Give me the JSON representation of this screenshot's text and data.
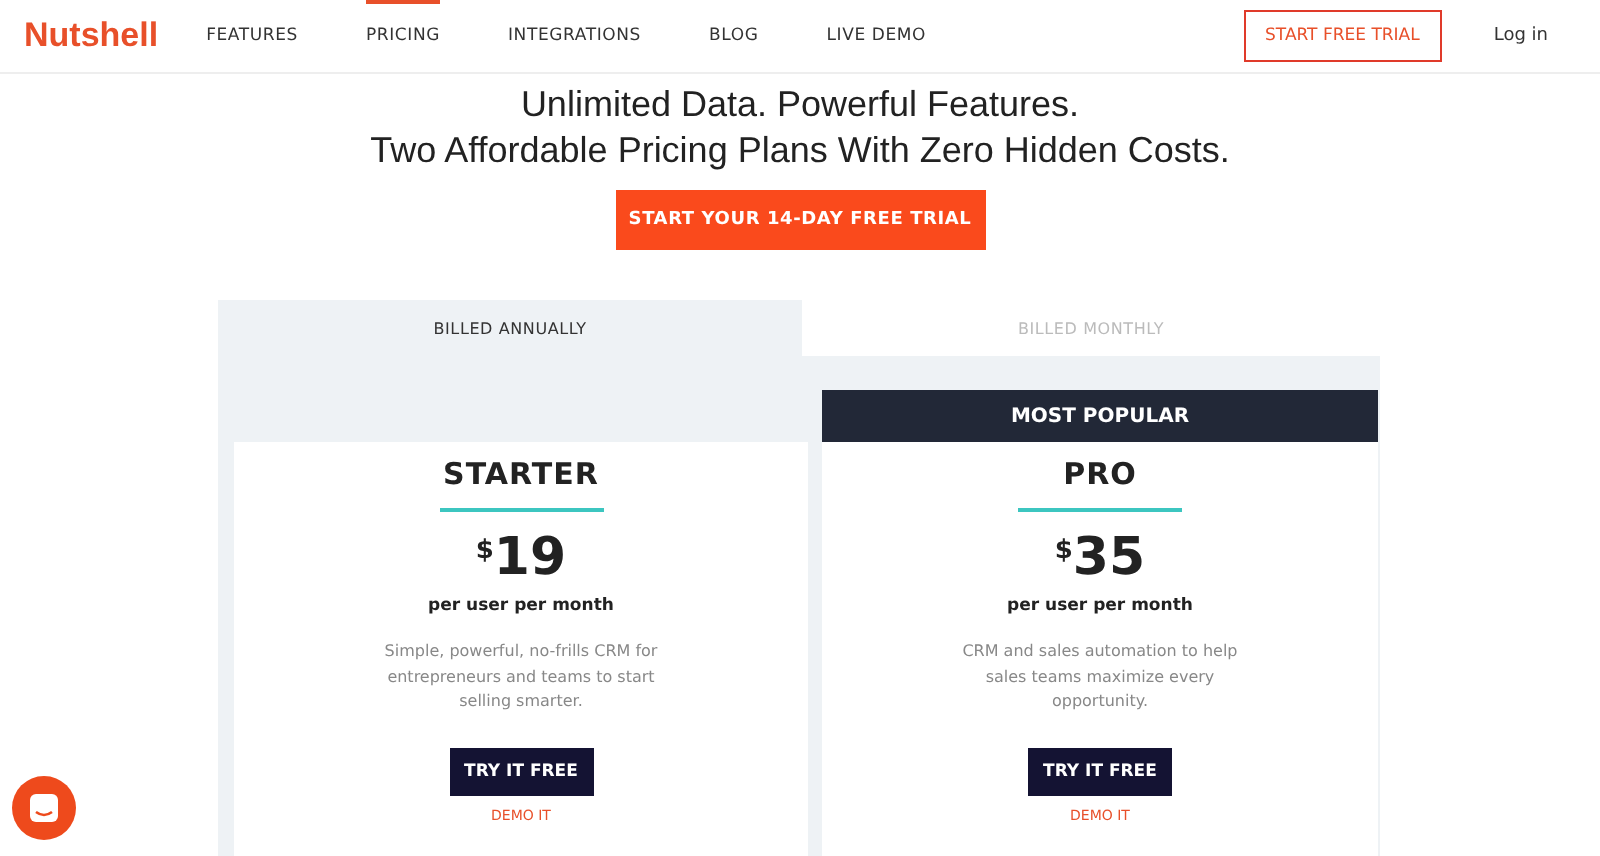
{
  "nav": {
    "logo": "Nutshell",
    "items": [
      {
        "label": "FEATURES",
        "selected": false
      },
      {
        "label": "PRICING",
        "selected": true
      },
      {
        "label": "INTEGRATIONS",
        "selected": false
      },
      {
        "label": "BLOG",
        "selected": false
      },
      {
        "label": "LIVE DEMO",
        "selected": false
      }
    ],
    "cta": "START FREE TRIAL",
    "login": "Log in"
  },
  "hero": {
    "headline": [
      "Unlimited Data. Powerful Features.",
      "Two Affordable Pricing Plans With Zero Hidden Costs."
    ],
    "cta": "START YOUR 14-DAY FREE TRIAL"
  },
  "billing_tabs": [
    {
      "label": "BILLED ANNUALLY",
      "selected": true
    },
    {
      "label": "BILLED MONTHLY",
      "selected": false
    }
  ],
  "plans": [
    {
      "name": "STARTER",
      "currency": "$",
      "price": "19",
      "period": "per user per month",
      "description": "Simple, powerful, no-frills CRM for entrepreneurs and teams to start selling smarter.",
      "button": "TRY IT FREE",
      "link": "DEMO IT"
    },
    {
      "badge": "MOST POPULAR",
      "name": "PRO",
      "currency": "$",
      "price": "35",
      "period": "per user per month",
      "description": "CRM and sales automation to help sales teams maximize every opportunity.",
      "button": "TRY IT FREE",
      "link": "DEMO IT"
    }
  ]
}
